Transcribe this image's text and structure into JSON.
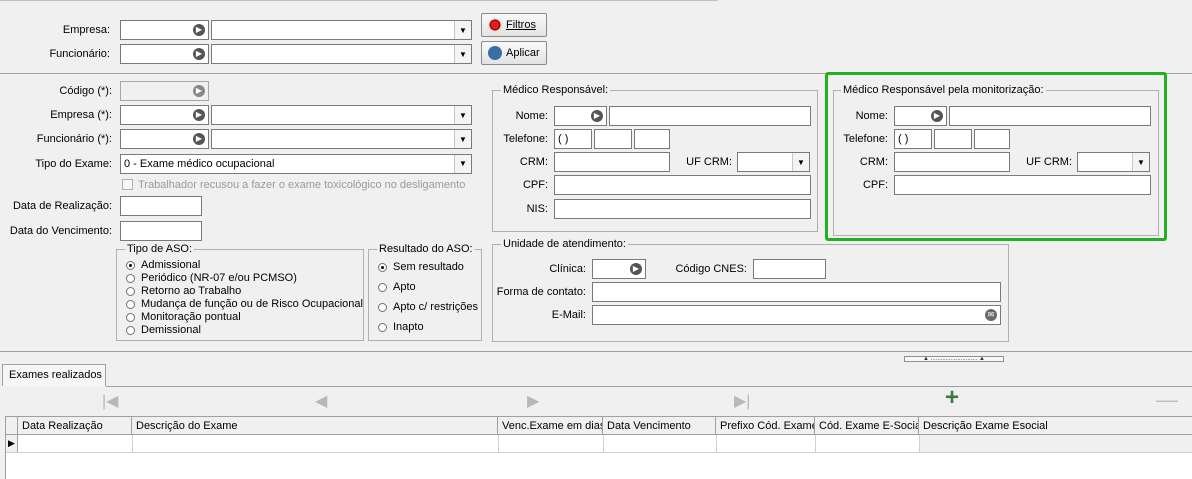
{
  "filter": {
    "empresa_label": "Empresa:",
    "funcionario_label": "Funcionário:",
    "filtros_button": "Filtros",
    "aplicar_button": "Aplicar"
  },
  "form": {
    "codigo_label": "Código (*):",
    "empresa_label": "Empresa (*):",
    "funcionario_label": "Funcionário (*):",
    "tipo_exame_label": "Tipo do Exame:",
    "tipo_exame_value": "0 - Exame médico ocupacional",
    "recusou_label": "Trabalhador recusou a fazer o exame toxicológico no desligamento",
    "data_realizacao_label": "Data de Realização:",
    "data_vencimento_label": "Data do Vencimento:"
  },
  "tipo_aso": {
    "title": "Tipo de ASO:",
    "options": [
      "Admissional",
      "Periódico (NR-07 e/ou PCMSO)",
      "Retorno ao Trabalho",
      "Mudança de função ou de Risco Ocupacional",
      "Monitoração pontual",
      "Demissional"
    ],
    "selected": 0
  },
  "resultado_aso": {
    "title": "Resultado do ASO:",
    "options": [
      "Sem resultado",
      "Apto",
      "Apto c/ restrições",
      "Inapto"
    ],
    "selected": 0
  },
  "medico": {
    "title": "Médico Responsável:",
    "nome_label": "Nome:",
    "telefone_label": "Telefone:",
    "telefone_mask": "(   )",
    "crm_label": "CRM:",
    "uf_crm_label": "UF CRM:",
    "cpf_label": "CPF:",
    "nis_label": "NIS:"
  },
  "medico_monit": {
    "title": "Médico Responsável pela monitorização:",
    "nome_label": "Nome:",
    "telefone_label": "Telefone:",
    "telefone_mask": "(   )",
    "crm_label": "CRM:",
    "uf_crm_label": "UF CRM:",
    "cpf_label": "CPF:"
  },
  "unidade": {
    "title": "Unidade de atendimento:",
    "clinica_label": "Clínica:",
    "cnes_label": "Código CNES:",
    "contato_label": "Forma de contato:",
    "email_label": "E-Mail:"
  },
  "tabs": [
    {
      "label": "Exames realizados"
    }
  ],
  "grid": {
    "columns": [
      "Data Realização",
      "Descrição do Exame",
      "Venc.Exame em dias",
      "Data Vencimento",
      "Prefixo Cód. Exame",
      "Cód. Exame E-Social",
      "Descrição Exame Esocial"
    ],
    "rows": []
  },
  "colors": {
    "highlight": "#22b022"
  }
}
